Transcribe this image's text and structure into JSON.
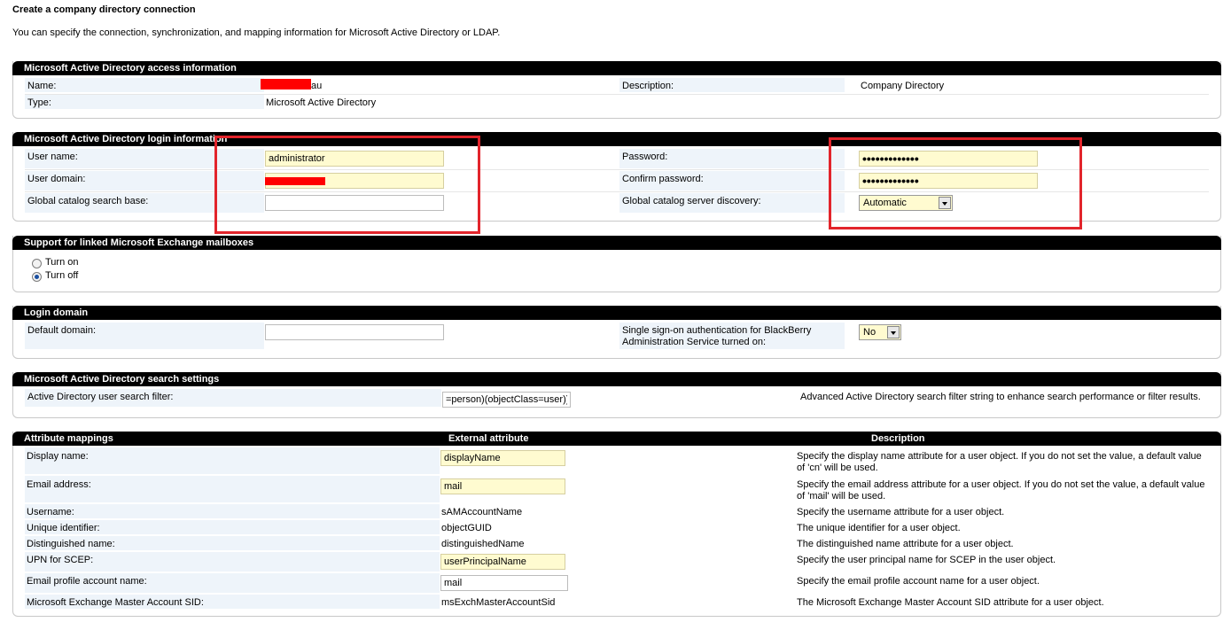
{
  "page": {
    "title": "Create a company directory connection",
    "intro": "You can specify the connection, synchronization, and mapping information for Microsoft Active Directory or LDAP."
  },
  "access_info": {
    "header": "Microsoft Active Directory access information",
    "name_label": "Name:",
    "name_value_suffix": "au",
    "type_label": "Type:",
    "type_value": "Microsoft Active Directory",
    "description_label": "Description:",
    "description_value": "Company Directory"
  },
  "login_info": {
    "header": "Microsoft Active Directory login information",
    "username_label": "User name:",
    "username_value": "administrator",
    "userdomain_label": "User domain:",
    "userdomain_value": "",
    "gc_base_label": "Global catalog search base:",
    "gc_base_value": "",
    "password_label": "Password:",
    "password_value": "•••••••••••••",
    "confirm_label": "Confirm password:",
    "confirm_value": "•••••••••••••",
    "gc_discovery_label": "Global catalog server discovery:",
    "gc_discovery_value": "Automatic"
  },
  "linked_mailboxes": {
    "header": "Support for linked Microsoft Exchange mailboxes",
    "turn_on": "Turn on",
    "turn_off": "Turn off",
    "selected": "Turn off"
  },
  "login_domain": {
    "header": "Login domain",
    "default_domain_label": "Default domain:",
    "default_domain_value": "",
    "sso_label_line1": "Single sign-on authentication for BlackBerry",
    "sso_label_line2": "Administration Service turned on:",
    "sso_value": "No"
  },
  "search_settings": {
    "header": "Microsoft Active Directory search settings",
    "filter_label": "Active Directory user search filter:",
    "filter_value": "=person)(objectClass=user))",
    "filter_desc": "Advanced Active Directory search filter string to enhance search performance or filter results."
  },
  "mappings": {
    "header": "Attribute mappings",
    "col_external": "External attribute",
    "col_description": "Description",
    "rows": [
      {
        "label": "Display name:",
        "value": "displayName",
        "kind": "yellow-input",
        "desc1": "Specify the display name attribute for a user object. If you do not set the value, a default value",
        "desc2": "of 'cn' will be used."
      },
      {
        "label": "Email address:",
        "value": "mail",
        "kind": "yellow-input",
        "desc1": "Specify the email address attribute for a user object. If you do not set the value, a default value",
        "desc2": "of 'mail' will be used."
      },
      {
        "label": "Username:",
        "value": "sAMAccountName",
        "kind": "text",
        "desc1": "Specify the username attribute for a user object.",
        "desc2": ""
      },
      {
        "label": "Unique identifier:",
        "value": "objectGUID",
        "kind": "text",
        "desc1": "The unique identifier for a user object.",
        "desc2": ""
      },
      {
        "label": "Distinguished name:",
        "value": "distinguishedName",
        "kind": "text",
        "desc1": "The distinguished name attribute for a user object.",
        "desc2": ""
      },
      {
        "label": "UPN for SCEP:",
        "value": "userPrincipalName",
        "kind": "yellow-input",
        "desc1": "Specify the user principal name for SCEP in the user object.",
        "desc2": ""
      },
      {
        "label": "Email profile account name:",
        "value": "mail",
        "kind": "white-input",
        "desc1": "Specify the email profile account name for a user object.",
        "desc2": ""
      },
      {
        "label": "Microsoft Exchange Master Account SID:",
        "value": "msExchMasterAccountSid",
        "kind": "text",
        "desc1": "The Microsoft Exchange Master Account SID attribute for a user object.",
        "desc2": ""
      }
    ]
  },
  "colors": {
    "header_bg": "#000000",
    "label_bg": "#eef4fa",
    "input_yellow": "#fffbd0",
    "highlight_red": "#e2242b"
  }
}
